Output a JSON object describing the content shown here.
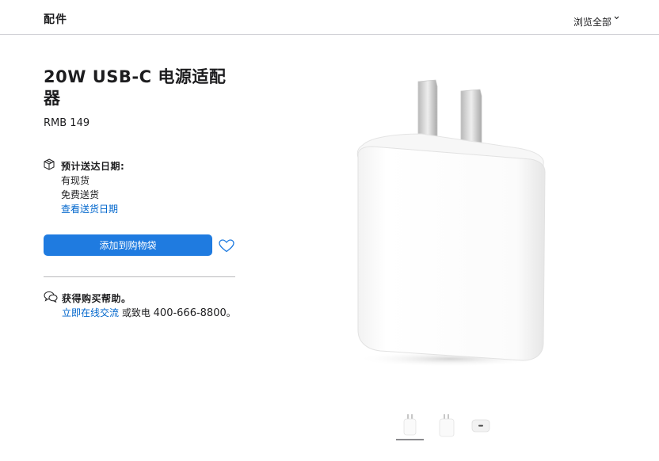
{
  "header": {
    "title": "配件",
    "browse_label": "浏览全部"
  },
  "product": {
    "title": "20W USB-C 电源适配器",
    "price": "RMB 149"
  },
  "delivery": {
    "heading": "预计送达日期:",
    "lines": [
      "有现货",
      "免费送货"
    ],
    "link_label": "查看送货日期"
  },
  "actions": {
    "add_to_bag_label": "添加到购物袋"
  },
  "help": {
    "heading": "获得购买帮助。",
    "chat_link_label": "立即在线交流",
    "call_text": " 或致电 ",
    "phone": "400-666-8800",
    "suffix": "。"
  },
  "colors": {
    "accent": "#1f7be0",
    "link": "#0066cc",
    "text": "#1d1d1f"
  },
  "gallery": {
    "thumbnail_count": 3,
    "selected_index": 0
  }
}
